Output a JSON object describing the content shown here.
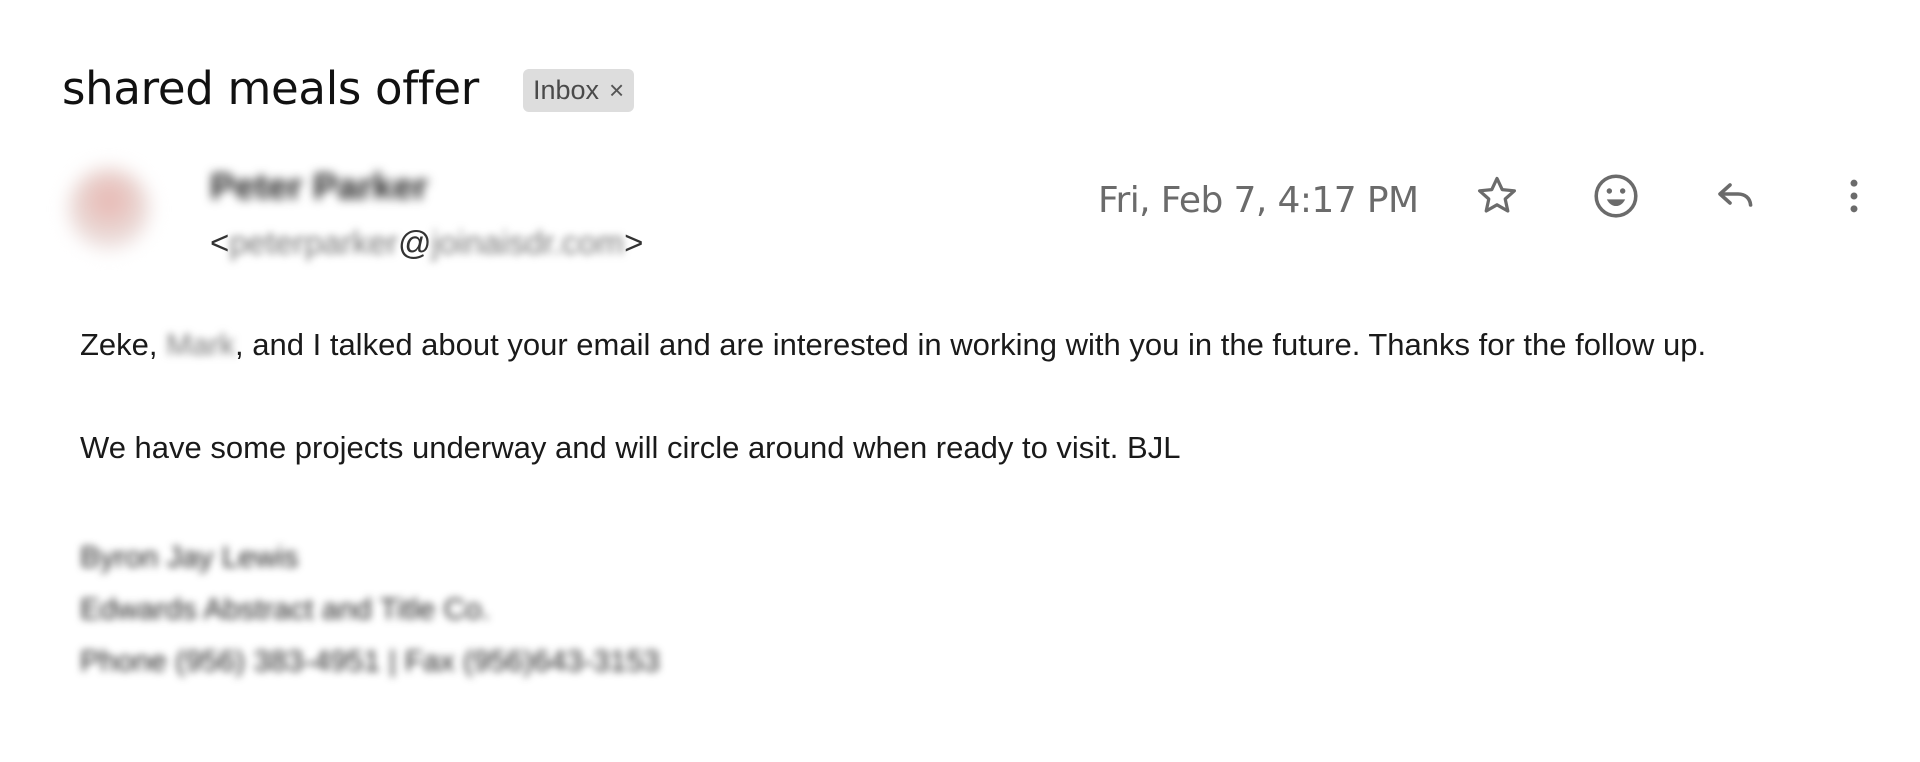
{
  "email": {
    "subject": "shared meals offer",
    "label": {
      "text": "Inbox",
      "close_glyph": "×"
    },
    "sender": {
      "name": "Peter Parker",
      "email_open": "<",
      "email_user": "peterparker",
      "email_at": "@",
      "email_domain": "joinaisdr.com",
      "email_close": ">"
    },
    "date": "Fri, Feb 7, 4:17 PM",
    "actions": [
      "star-icon",
      "emoji-reaction-icon",
      "reply-icon",
      "more-vert-icon"
    ],
    "body": {
      "line1_start": "Zeke, ",
      "line1_name": "Mark",
      "line1_end": ", and I talked about your email and are interested in working with you in the future. Thanks for the follow up.",
      "line2": "We have some projects underway and will circle around when ready to visit. BJL"
    },
    "signature": {
      "name": "Byron Jay Lewis",
      "company": "Edwards Abstract and Title Co.",
      "phone": "Phone (956) 383-4951 | Fax (956)643-3153"
    }
  },
  "colors": {
    "label_bg": "#dddddd",
    "icon_gray": "#6b6b6b",
    "text": "#1a1a1a"
  }
}
